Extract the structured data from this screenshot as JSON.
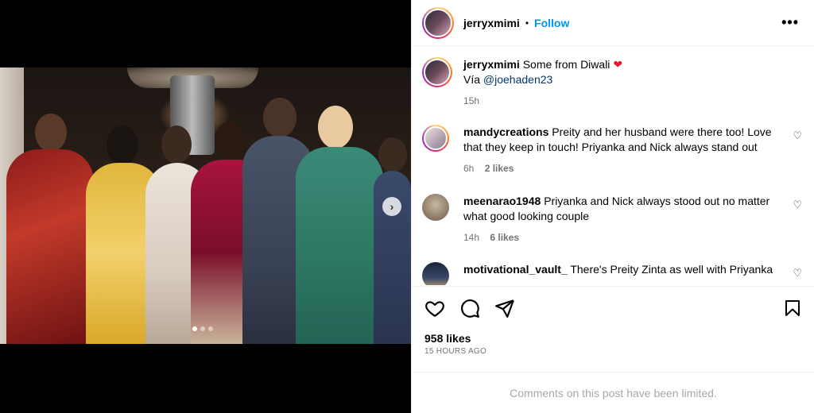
{
  "post": {
    "username": "jerryxmimi",
    "separator": "•",
    "follow_label": "Follow",
    "more_label": "•••"
  },
  "caption": {
    "username": "jerryxmimi",
    "text": "Some from Diwali",
    "via": "Vía",
    "mention": "@joehaden23",
    "time": "15h"
  },
  "comments": [
    {
      "username": "mandycreations",
      "text": "Preity and her husband were there too! Love that they keep in touch! Priyanka and Nick always stand out",
      "time": "6h",
      "likes": "2 likes"
    },
    {
      "username": "meenarao1948",
      "text": "Priyanka and Nick always stood out no matter what good looking couple",
      "time": "14h",
      "likes": "6 likes"
    },
    {
      "username": "motivational_vault_",
      "text": "There's Preity Zinta as well with Priyanka"
    }
  ],
  "footer": {
    "likes": "958 likes",
    "timestamp": "15 HOURS AGO",
    "limited_notice": "Comments on this post have been limited."
  },
  "carousel": {
    "next_icon": "›"
  }
}
